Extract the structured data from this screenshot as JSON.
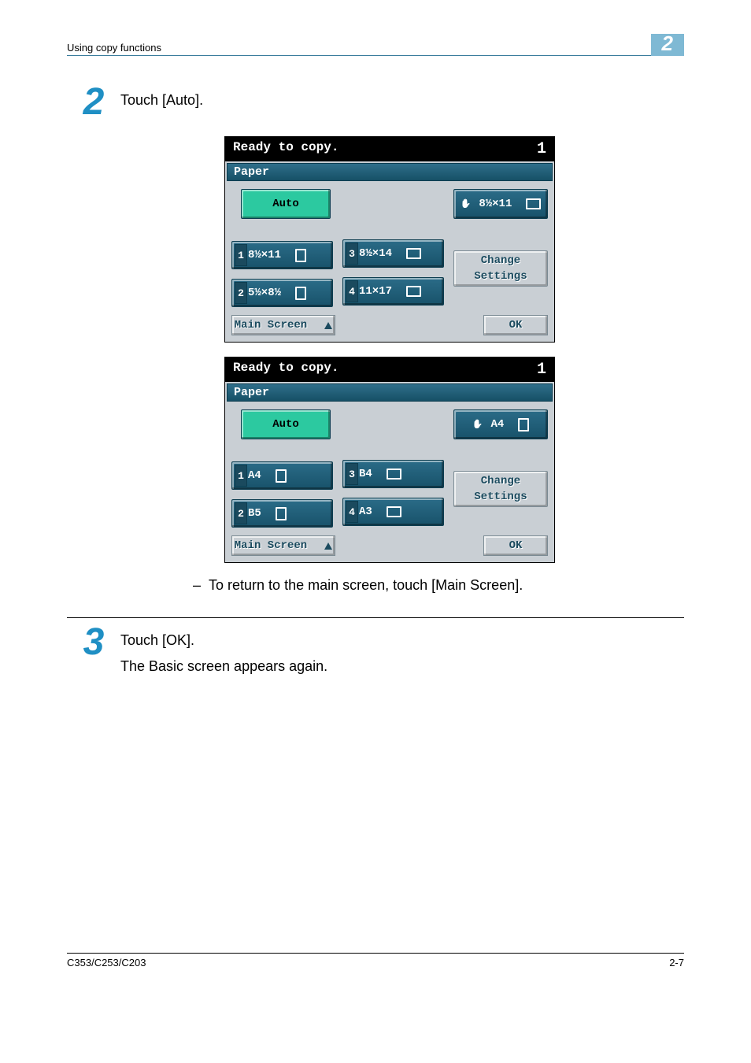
{
  "header": {
    "section_title": "Using copy functions",
    "chapter_number": "2"
  },
  "step2": {
    "number": "2",
    "instruction": "Touch [Auto]."
  },
  "panel_a": {
    "status": "Ready to copy.",
    "counter": "1",
    "section_label": "Paper",
    "auto": "Auto",
    "bypass": "8½×11",
    "tray1": "8½×11",
    "tray2": "5½×8½",
    "tray3": "8½×14",
    "tray4": "11×17",
    "change_l1": "Change",
    "change_l2": "Settings",
    "main_screen": "Main Screen",
    "ok": "OK"
  },
  "panel_b": {
    "status": "Ready to copy.",
    "counter": "1",
    "section_label": "Paper",
    "auto": "Auto",
    "bypass": "A4",
    "tray1": "A4",
    "tray2": "B5",
    "tray3": "B4",
    "tray4": "A3",
    "change_l1": "Change",
    "change_l2": "Settings",
    "main_screen": "Main Screen",
    "ok": "OK"
  },
  "note": {
    "dash": "–",
    "text": "To return to the main screen, touch [Main Screen]."
  },
  "step3": {
    "number": "3",
    "instruction": "Touch [OK].",
    "result": "The Basic screen appears again."
  },
  "footer": {
    "model": "C353/C253/C203",
    "page": "2-7"
  }
}
